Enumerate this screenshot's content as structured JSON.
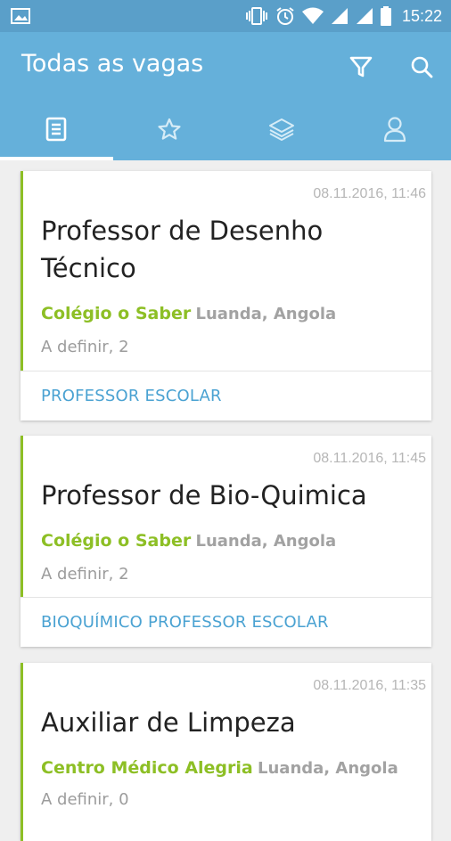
{
  "status_bar": {
    "time": "15:22",
    "icons": [
      "image-icon",
      "vibrate-icon",
      "alarm-icon",
      "wifi-icon",
      "signal-icon",
      "signal-icon",
      "battery-icon"
    ]
  },
  "app_bar": {
    "title": "Todas as vagas",
    "actions": [
      "filter-icon",
      "search-icon"
    ]
  },
  "tabs": [
    {
      "icon": "document-icon",
      "active": true
    },
    {
      "icon": "star-icon",
      "active": false
    },
    {
      "icon": "layers-icon",
      "active": false
    },
    {
      "icon": "person-icon",
      "active": false
    }
  ],
  "jobs": [
    {
      "date": "08.11.2016, 11:46",
      "title_line1": "Professor de Desenho",
      "title_line2": "Técnico",
      "company": "Colégio o Saber",
      "location": "Luanda, Angola",
      "meta": "A definir, 2",
      "category": "PROFESSOR ESCOLAR"
    },
    {
      "date": "08.11.2016, 11:45",
      "title_line1": "Professor de Bio-Quimica",
      "company": "Colégio o Saber",
      "location": "Luanda, Angola",
      "meta": "A definir, 2",
      "category": "BIOQUÍMICO PROFESSOR ESCOLAR"
    },
    {
      "date": "08.11.2016, 11:35",
      "title_line1": "Auxiliar de Limpeza",
      "company": "Centro Médico Alegria",
      "location": "Luanda, Angola",
      "meta": "A definir, 0"
    }
  ],
  "colors": {
    "status_bar": "#5a9fc9",
    "app_bar": "#65b0da",
    "accent_green": "#8dbf25",
    "category_blue": "#4aa2d2"
  }
}
